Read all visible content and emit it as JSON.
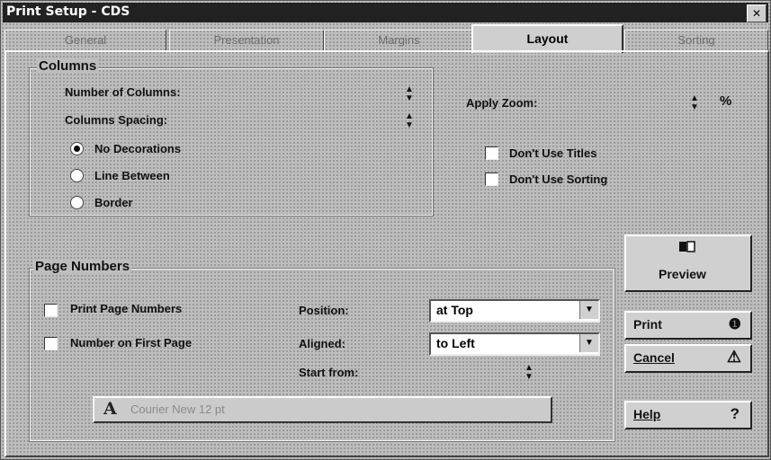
{
  "window": {
    "title": "Print Setup - CDS",
    "close_glyph": "✕"
  },
  "tabs": [
    "General",
    "Presentation",
    "Margins",
    "Layout",
    "Sorting"
  ],
  "active_tab": "Layout",
  "columns": {
    "title": "Columns",
    "number_label": "Number of Columns:",
    "spacing_label": "Columns Spacing:",
    "radios": [
      "No Decorations",
      "Line Between",
      "Border"
    ],
    "selected_radio": "No Decorations"
  },
  "zoom": {
    "label": "Apply Zoom:",
    "unit": "%"
  },
  "options": {
    "dont_use_titles": "Don't Use Titles",
    "dont_use_sorting": "Don't Use Sorting"
  },
  "page_numbers": {
    "title": "Page Numbers",
    "print_label": "Print Page Numbers",
    "first_page_label": "Number on First Page",
    "position_label": "Position:",
    "position_value": "at Top",
    "aligned_label": "Aligned:",
    "aligned_value": "to Left",
    "start_label": "Start from:",
    "font_glyph": "A",
    "font_text": "Courier New 12 pt"
  },
  "buttons": {
    "preview": "Preview",
    "print": "Print",
    "cancel": "Cancel",
    "help": "Help",
    "print_icon_glyph": "❶",
    "cancel_icon_glyph": "⚠",
    "help_icon_glyph": "?"
  },
  "icons": {
    "preview": "book-preview-icon",
    "print": "printer-icon",
    "cancel": "warning-icon",
    "help": "question-icon",
    "spin": "spinner-arrows-icon",
    "dropdown": "dropdown-arrow-icon"
  },
  "colors": {
    "title_bg": "#222222",
    "face": "#bdbdbd",
    "white": "#ffffff"
  }
}
